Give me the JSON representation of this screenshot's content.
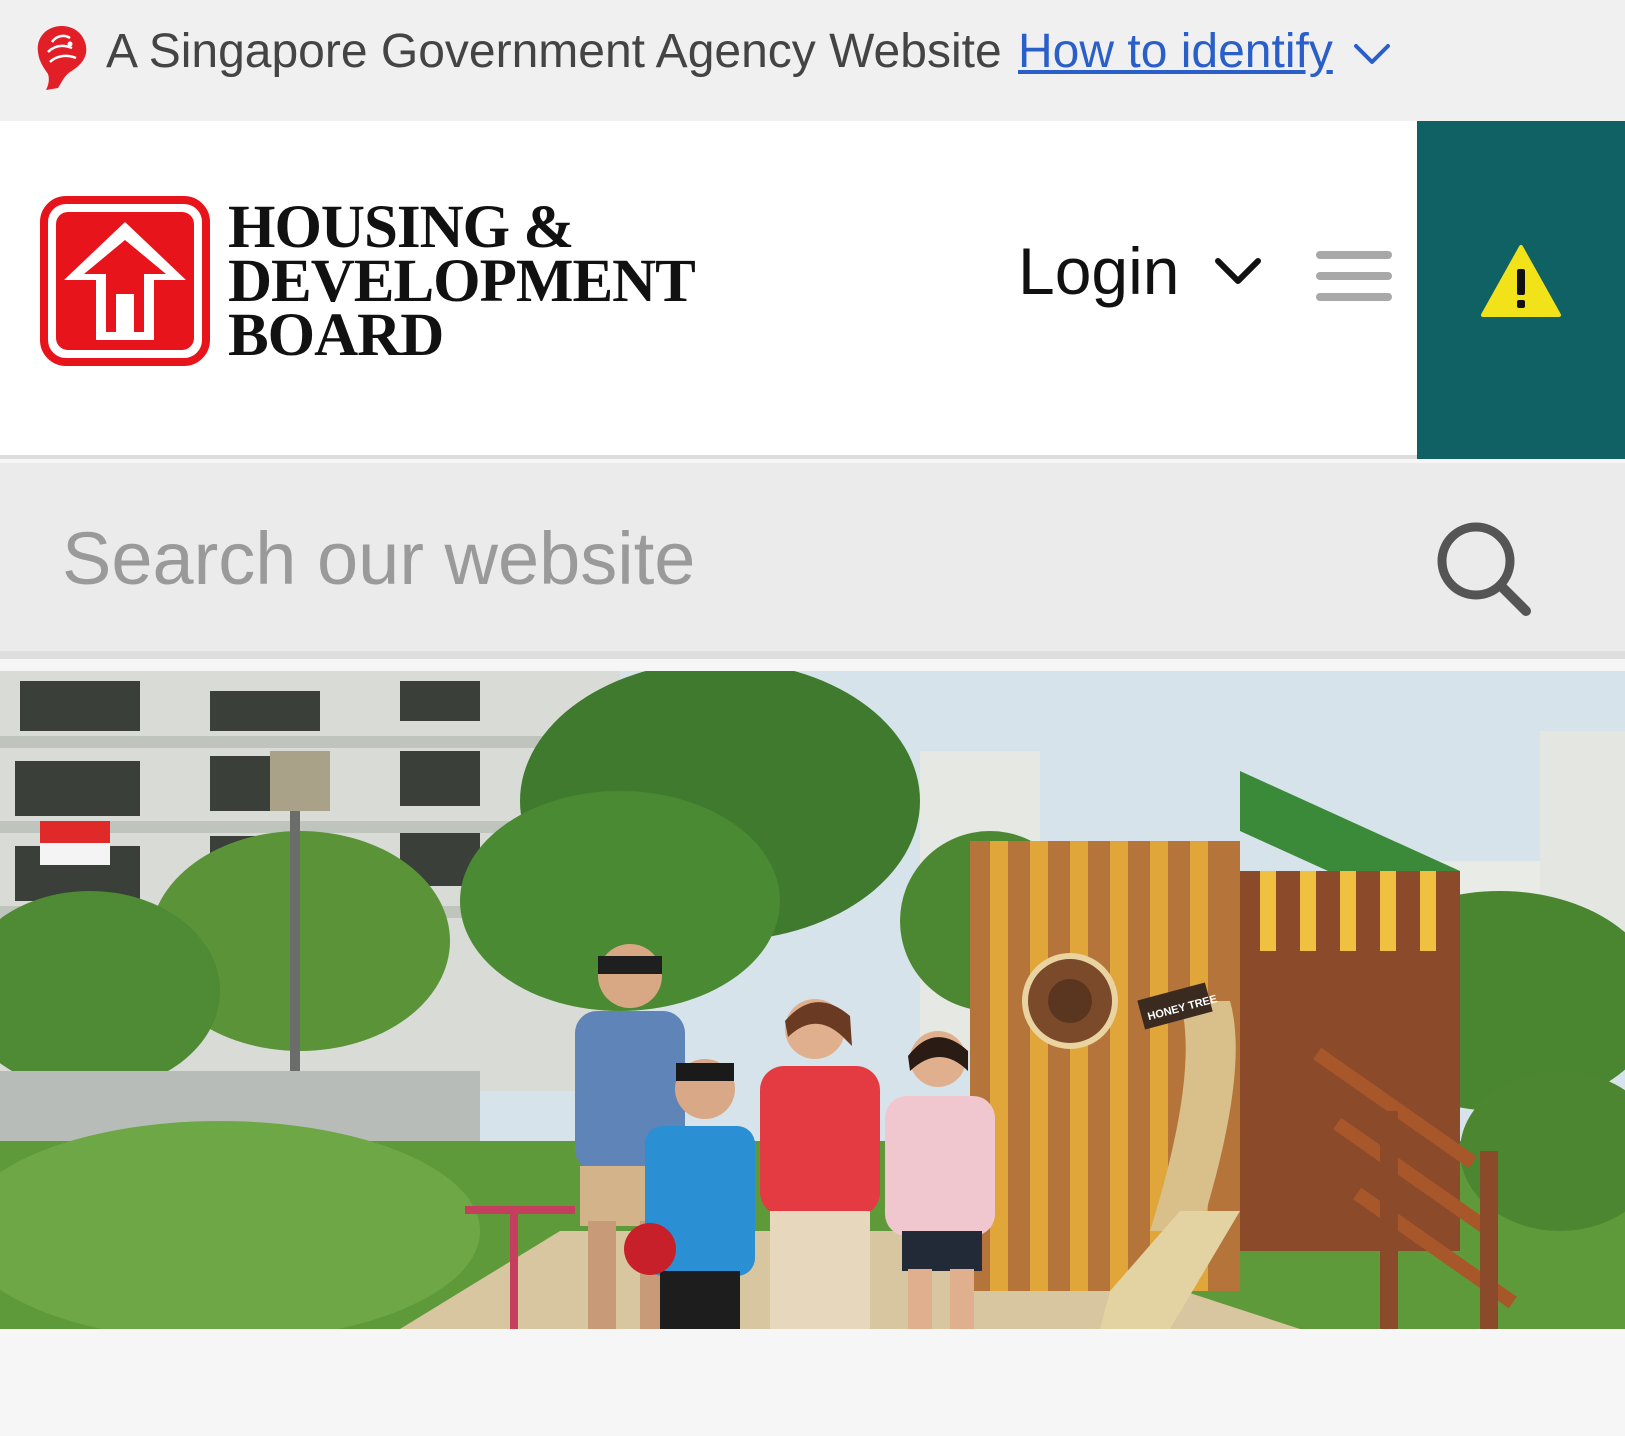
{
  "gov_masthead": {
    "agency_text": "A Singapore Government Agency Website",
    "identify_link": "How to identify",
    "icons": {
      "merlion": "merlion-icon",
      "chevron": "chevron-down-icon"
    }
  },
  "header": {
    "logo": {
      "line1": "HOUSING &",
      "line2": "DEVELOPMENT",
      "line3": "BOARD",
      "icon": "hdb-house-logo"
    },
    "login_label": "Login",
    "menu_icon": "hamburger-icon",
    "alert_icon": "warning-icon",
    "colors": {
      "alert_bg": "#0f6164",
      "alert_icon": "#f2e21a",
      "logo_red": "#e8141b"
    }
  },
  "search": {
    "placeholder": "Search our website",
    "value": "",
    "icon": "search-icon"
  },
  "hero": {
    "image_alt": "Family walking near a playground in a housing estate",
    "playhouse_sign": "HONEY TREE"
  }
}
